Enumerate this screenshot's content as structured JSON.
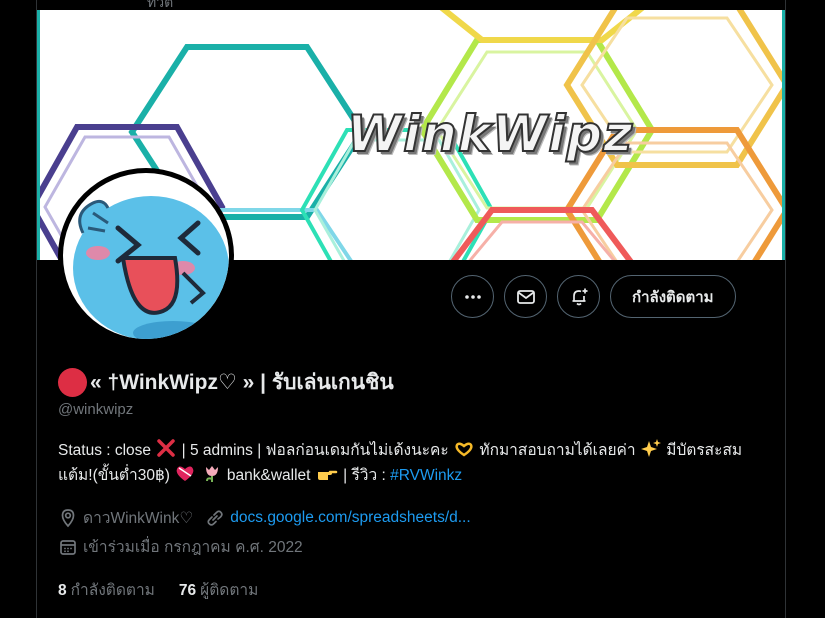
{
  "header": {
    "partial_text": "ทวีต"
  },
  "banner": {
    "title": "WinkWipz",
    "border_color": "#1ab0a8"
  },
  "profile": {
    "display_name": "« †WinkWipz♡ » | รับเล่นเกนชิน",
    "handle": "@winkwipz",
    "status_dot_color": "#dd2e44"
  },
  "actions": {
    "more_icon": "more-dots-icon",
    "message_icon": "envelope-icon",
    "notify_icon": "bell-plus-icon",
    "follow_label": "กำลังติดตาม"
  },
  "bio": {
    "part1": "Status : close",
    "part2": " | 5 admins | ฟอลก่อนเดมกันไม่เด้งนะคะ",
    "part3": " ทักมาสอบถามได้เลยค่า",
    "part4": " มีบัตรสะสมแต้ม!(ขั้นต่ำ30฿)",
    "part5": " bank&wallet ",
    "part6": " | รีวิว : ",
    "hashtag": "#RVWinkz"
  },
  "meta": {
    "location": "ดาวWinkWink♡",
    "link": "docs.google.com/spreadsheets/d...",
    "joined": "เข้าร่วมเมื่อ กรกฎาคม ค.ศ. 2022"
  },
  "counts": {
    "following_num": "8",
    "following_label": "กำลังติดตาม",
    "followers_num": "76",
    "followers_label": "ผู้ติดตาม"
  },
  "colors": {
    "accent": "#1d9bf0",
    "muted": "#71767b",
    "text": "#e7e9ea",
    "border": "#2f3336"
  }
}
